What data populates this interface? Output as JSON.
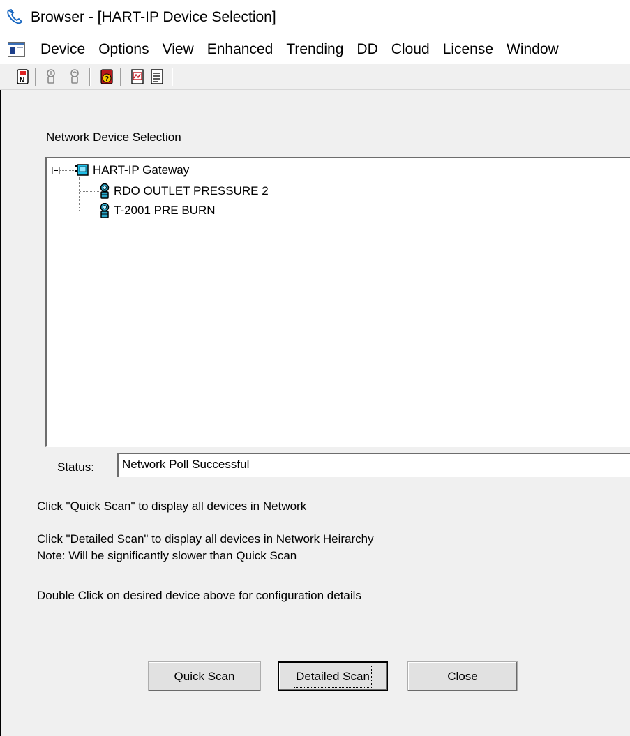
{
  "window": {
    "title": "Browser - [HART-IP Device Selection]"
  },
  "menu": {
    "items": [
      "Device",
      "Options",
      "View",
      "Enhanced",
      "Trending",
      "DD",
      "Cloud",
      "License",
      "Window"
    ]
  },
  "toolbar": {
    "buttons": [
      "network-device-icon",
      "device-disabled-icon",
      "device-disabled-2-icon",
      "device-help-icon",
      "report-icon",
      "document-icon"
    ]
  },
  "dialog": {
    "section_label": "Network Device Selection",
    "tree": {
      "root": "HART-IP Gateway",
      "children": [
        "RDO OUTLET PRESSURE 2",
        "T-2001 PRE BURN"
      ]
    },
    "status_label": "Status:",
    "status_value": "Network Poll Successful",
    "help": {
      "quick": "Click \"Quick Scan\" to display all devices in Network",
      "detailed": "Click \"Detailed Scan\" to display all devices in Network Heirarchy",
      "note": "Note: Will be significantly slower than Quick Scan",
      "double_click": "Double Click on desired device above for configuration details"
    },
    "buttons": {
      "quick_scan": "Quick Scan",
      "detailed_scan": "Detailed Scan",
      "close": "Close"
    }
  },
  "colors": {
    "client_bg": "#f0f0f0",
    "gateway_icon": "#1fbfe8",
    "device_icon": "#2aa6c9"
  }
}
